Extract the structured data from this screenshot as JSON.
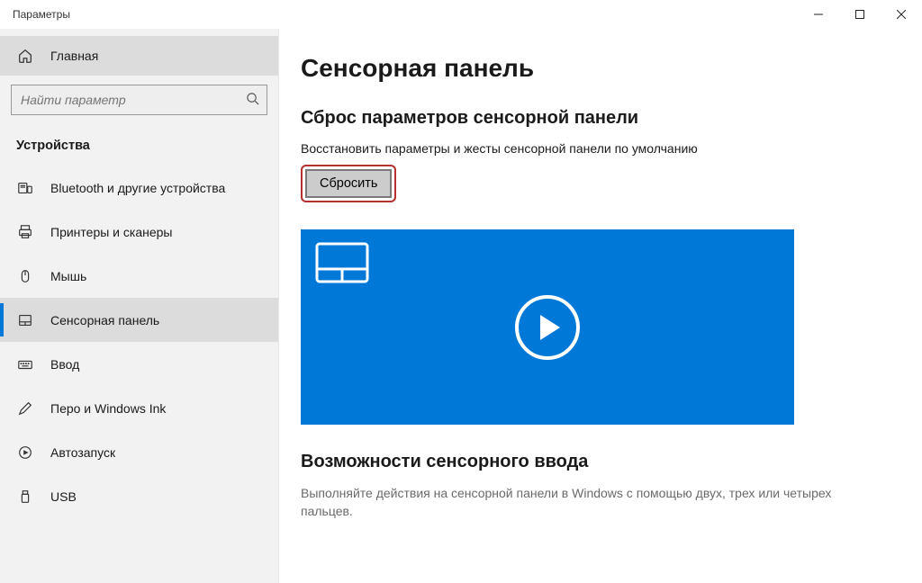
{
  "window": {
    "title": "Параметры"
  },
  "sidebar": {
    "home": "Главная",
    "search_placeholder": "Найти параметр",
    "category": "Устройства",
    "items": [
      {
        "id": "bluetooth",
        "label": "Bluetooth и другие устройства"
      },
      {
        "id": "printers",
        "label": "Принтеры и сканеры"
      },
      {
        "id": "mouse",
        "label": "Мышь"
      },
      {
        "id": "touchpad",
        "label": "Сенсорная панель",
        "selected": true
      },
      {
        "id": "typing",
        "label": "Ввод"
      },
      {
        "id": "pen",
        "label": "Перо и Windows Ink"
      },
      {
        "id": "autoplay",
        "label": "Автозапуск"
      },
      {
        "id": "usb",
        "label": "USB"
      }
    ]
  },
  "main": {
    "title": "Сенсорная панель",
    "reset_heading": "Сброс параметров сенсорной панели",
    "reset_desc": "Восстановить параметры и жесты сенсорной панели по умолчанию",
    "reset_button": "Сбросить",
    "capabilities_heading": "Возможности сенсорного ввода",
    "capabilities_desc": "Выполняйте действия на сенсорной панели в Windows с помощью двух, трех или четырех пальцев."
  }
}
